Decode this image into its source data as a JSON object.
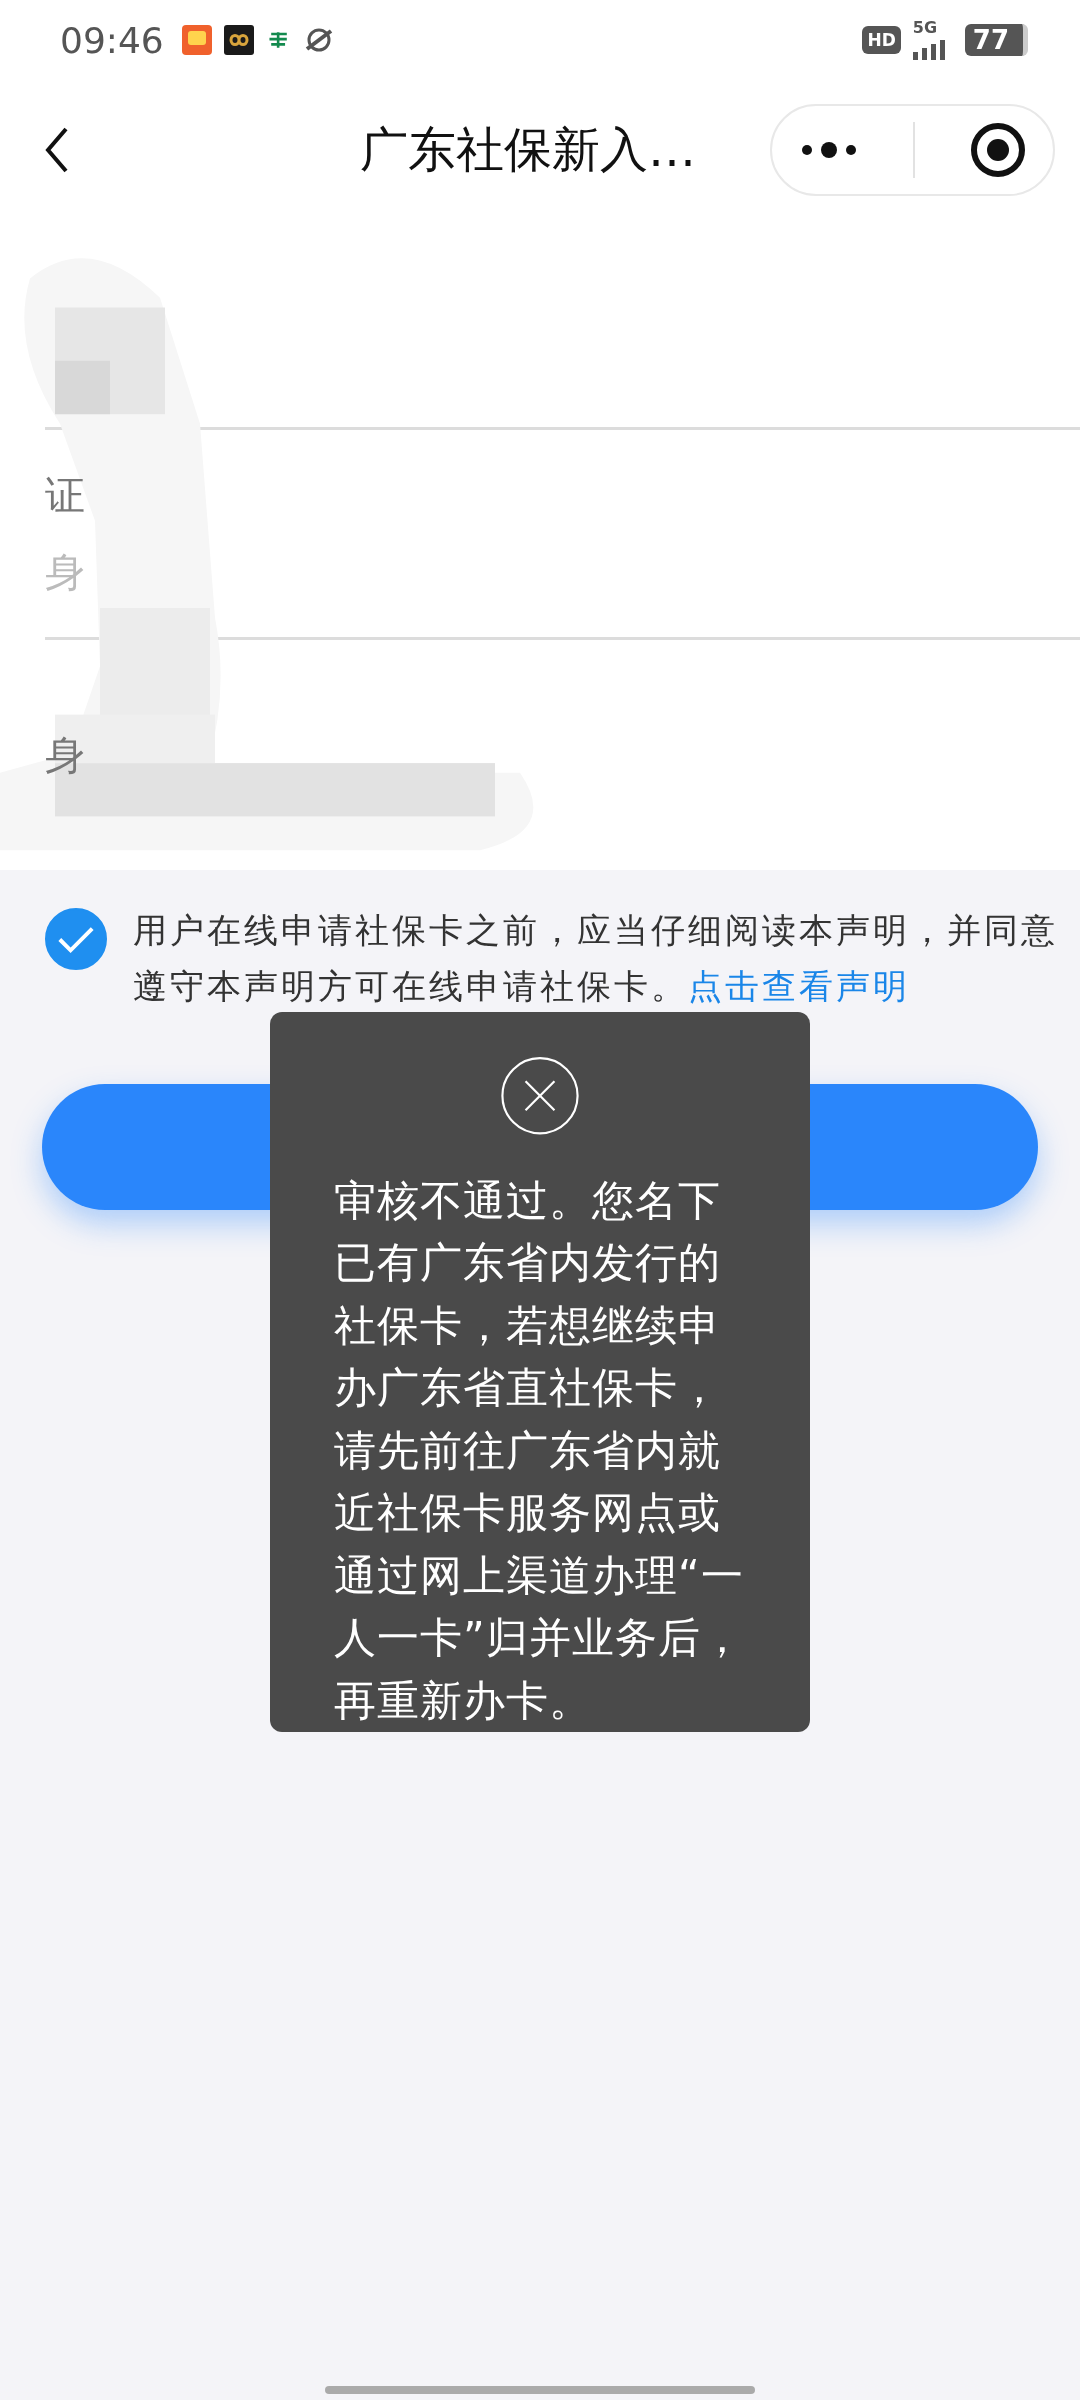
{
  "status_bar": {
    "time": "09:46",
    "network": "5G",
    "battery": "77",
    "hd": "HD"
  },
  "nav": {
    "title": "广东社保新入…"
  },
  "form": {
    "fields": [
      {
        "label": "证",
        "placeholder": "身"
      },
      {
        "label": "身"
      }
    ]
  },
  "agreement": {
    "checked": true,
    "text": "用户在线申请社保卡之前，应当仔细阅读本声明，并同意遵守本声明方可在线申请社保卡。",
    "link": "点击查看声明"
  },
  "toast": {
    "message": "审核不通过。您名下已有广东省内发行的社保卡，若想继续申办广东省直社保卡，请先前往广东省内就近社保卡服务网点或通过网上渠道办理“一人一卡”归并业务后，再重新办卡。"
  }
}
